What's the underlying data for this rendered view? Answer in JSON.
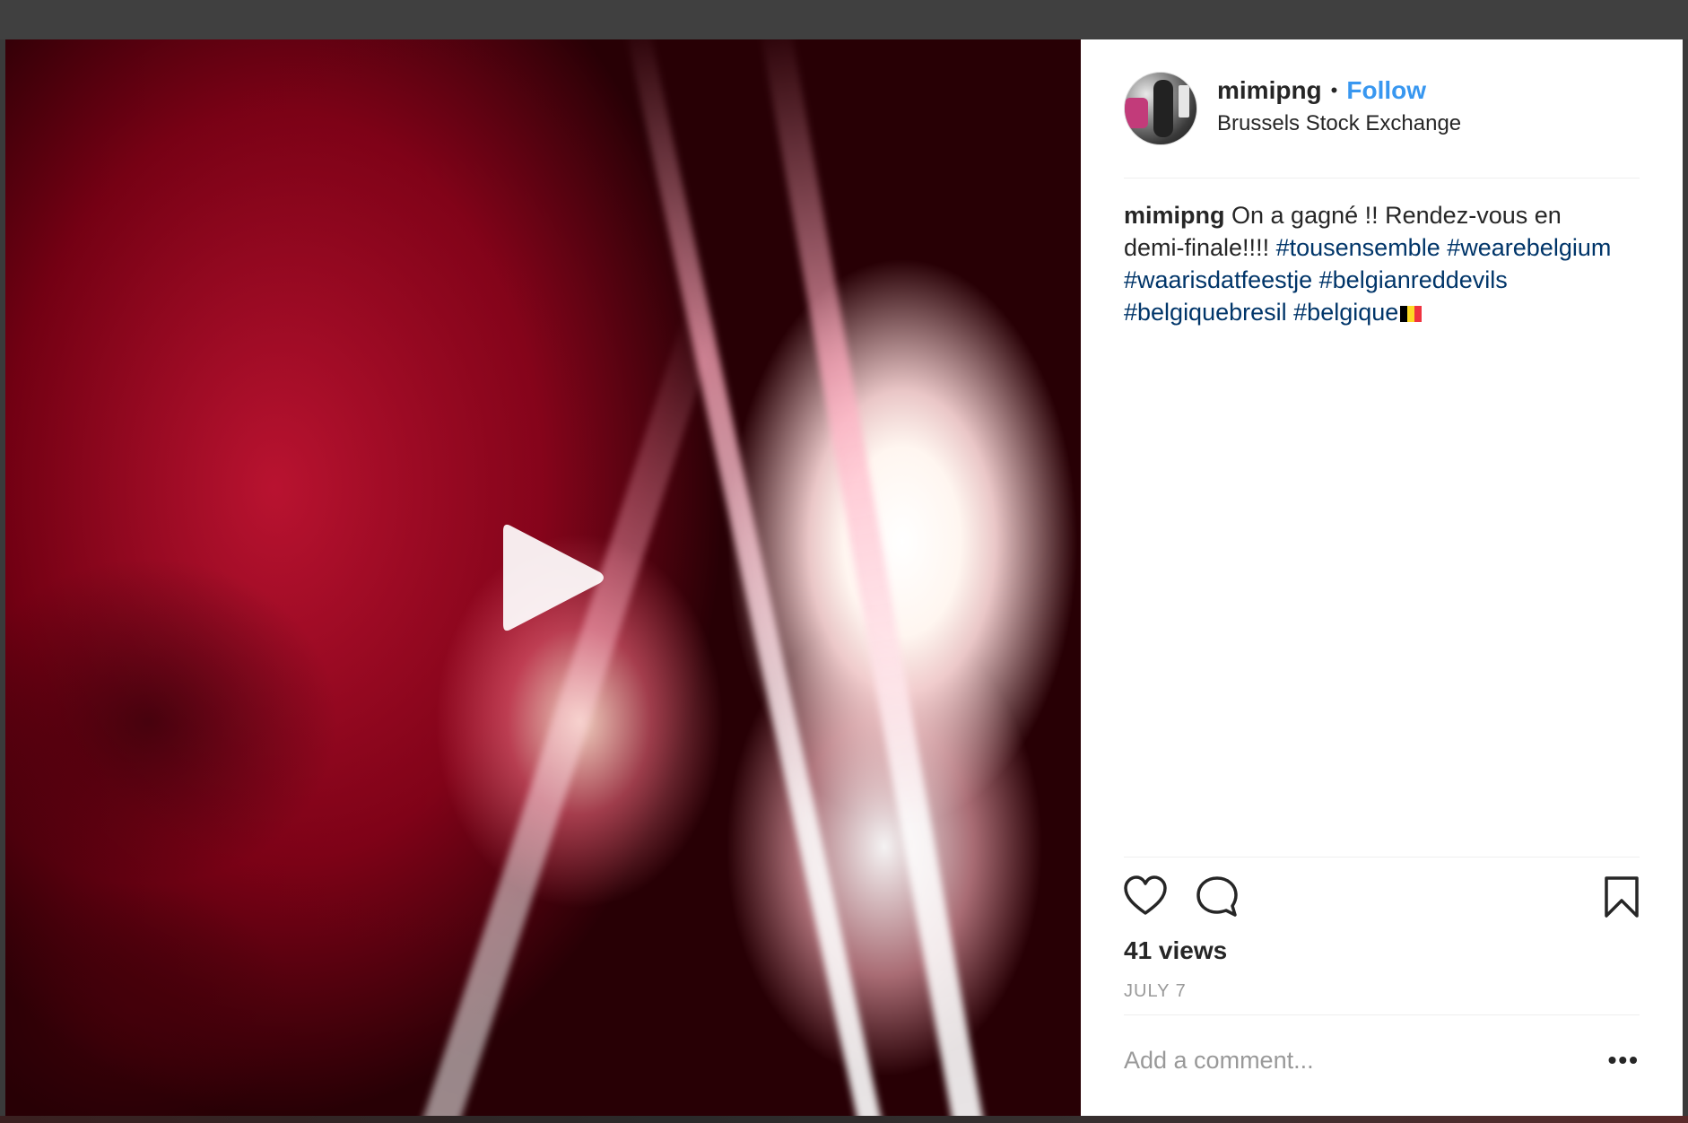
{
  "post": {
    "username": "mimipng",
    "separator": "•",
    "follow_label": "Follow",
    "location": "Brussels Stock Exchange",
    "caption": {
      "username": "mimipng",
      "text": "On a gagné !! Rendez-vous en demi-finale!!!!",
      "hashtags": [
        "#tousensemble",
        "#wearebelgium",
        "#waarisdatfeestje",
        "#belgianreddevils",
        "#belgiquebresil",
        "#belgique"
      ],
      "emoji": "belgium-flag"
    },
    "views": "41 views",
    "date": "JULY 7",
    "comment_placeholder": "Add a comment...",
    "more_label": "•••"
  },
  "icons": {
    "like": "heart-icon",
    "comment": "comment-bubble-icon",
    "save": "bookmark-icon",
    "play": "play-icon"
  },
  "colors": {
    "link": "#3897f0",
    "hashtag": "#003569",
    "text": "#262626",
    "muted": "#999999",
    "divider": "#efefef"
  }
}
